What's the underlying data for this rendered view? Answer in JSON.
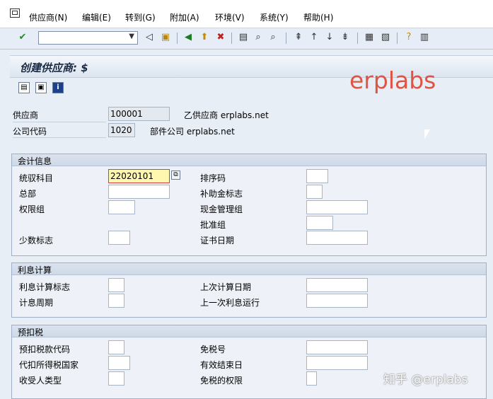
{
  "menu": [
    "供应商(N)",
    "编辑(E)",
    "转到(G)",
    "附加(A)",
    "环境(V)",
    "系统(Y)",
    "帮助(H)"
  ],
  "title": "创建供应商: $",
  "watermark": "erplabs",
  "header": {
    "vendor_label": "供应商",
    "vendor_value": "100001",
    "vendor_desc": "乙供应商 erplabs.net",
    "company_label": "公司代码",
    "company_value": "1020",
    "company_desc": "部件公司 erplabs.net"
  },
  "groups": {
    "accounting": {
      "title": "会计信息",
      "recon_label": "统驭科目",
      "recon_value": "22020101",
      "head_office_label": "总部",
      "auth_group_label": "权限组",
      "minority_label": "少数标志",
      "sort_key_label": "排序码",
      "subsidy_label": "补助金标志",
      "cash_mgmt_label": "现金管理组",
      "release_group_label": "批准组",
      "cert_date_label": "证书日期"
    },
    "interest": {
      "title": "利息计算",
      "indicator_label": "利息计算标志",
      "cycle_label": "计息周期",
      "last_calc_label": "上次计算日期",
      "last_run_label": "上一次利息运行"
    },
    "withholding": {
      "title": "预扣税",
      "wt_code_label": "预扣税款代码",
      "wt_country_label": "代扣所得税国家",
      "recipient_label": "收受人类型",
      "exemption_no_label": "免税号",
      "valid_until_label": "有效结束日",
      "exemption_auth_label": "免税的权限"
    }
  },
  "zhihu_watermark": "知乎 @erplabs"
}
